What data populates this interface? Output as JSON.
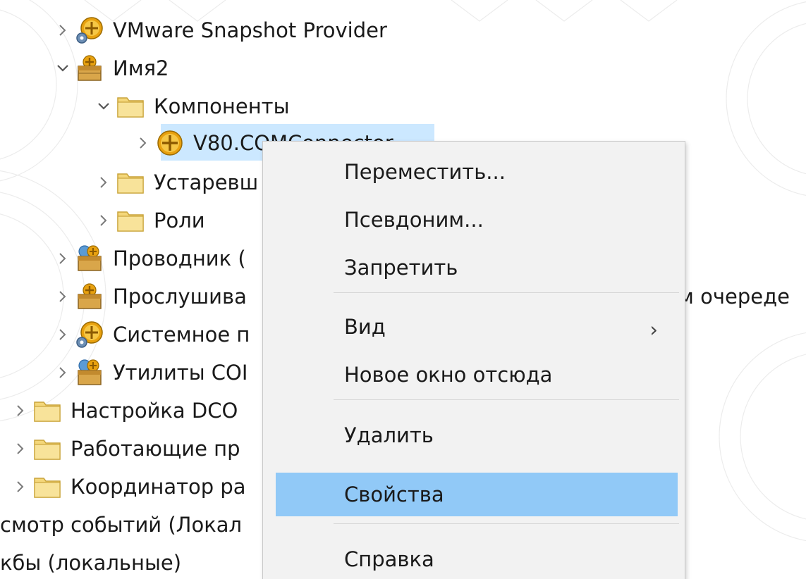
{
  "tree": {
    "items": [
      {
        "label": "VMware Snapshot Provider",
        "icon": "com-app-gear-icon",
        "expanded": false
      },
      {
        "label": "Имя2",
        "icon": "com-package-icon",
        "expanded": true
      },
      {
        "label": "Компоненты",
        "icon": "folder-icon",
        "expanded": true
      },
      {
        "label": "V80.COMConnector",
        "icon": "com-component-icon",
        "expanded": false,
        "selected": true
      },
      {
        "label": "Устаревш",
        "icon": "folder-icon",
        "expanded": false
      },
      {
        "label": "Роли",
        "icon": "folder-icon",
        "expanded": false
      },
      {
        "label": "Проводник (",
        "icon": "com-package-network-icon",
        "expanded": false
      },
      {
        "label": "Прослушива",
        "icon": "com-package-icon",
        "expanded": false
      },
      {
        "label": "Системное п",
        "icon": "com-app-gear-icon",
        "expanded": false
      },
      {
        "label": "Утилиты COI",
        "icon": "com-package-network-icon",
        "expanded": false
      },
      {
        "label": "Настройка DCO",
        "icon": "folder-icon",
        "expanded": false
      },
      {
        "label": "Работающие пр",
        "icon": "folder-icon",
        "expanded": false
      },
      {
        "label": "Координатор ра",
        "icon": "folder-icon",
        "expanded": false
      },
      {
        "label": "смотр событий (Локал"
      },
      {
        "label": "кбы (локальные)"
      }
    ],
    "overflow_text": "м очереде"
  },
  "context_menu": {
    "items": [
      {
        "label": "Переместить..."
      },
      {
        "label": "Псевдоним..."
      },
      {
        "label": "Запретить"
      },
      {
        "label": "Вид",
        "submenu_arrow": "›"
      },
      {
        "label": "Новое окно отсюда"
      },
      {
        "label": "Удалить"
      },
      {
        "label": "Свойства",
        "highlighted": true
      },
      {
        "label": "Справка"
      }
    ]
  },
  "colors": {
    "selection": "#cce8ff",
    "menu_highlight": "#91c9f7",
    "menu_background": "#f2f2f2",
    "folder": "#f4d77a"
  }
}
